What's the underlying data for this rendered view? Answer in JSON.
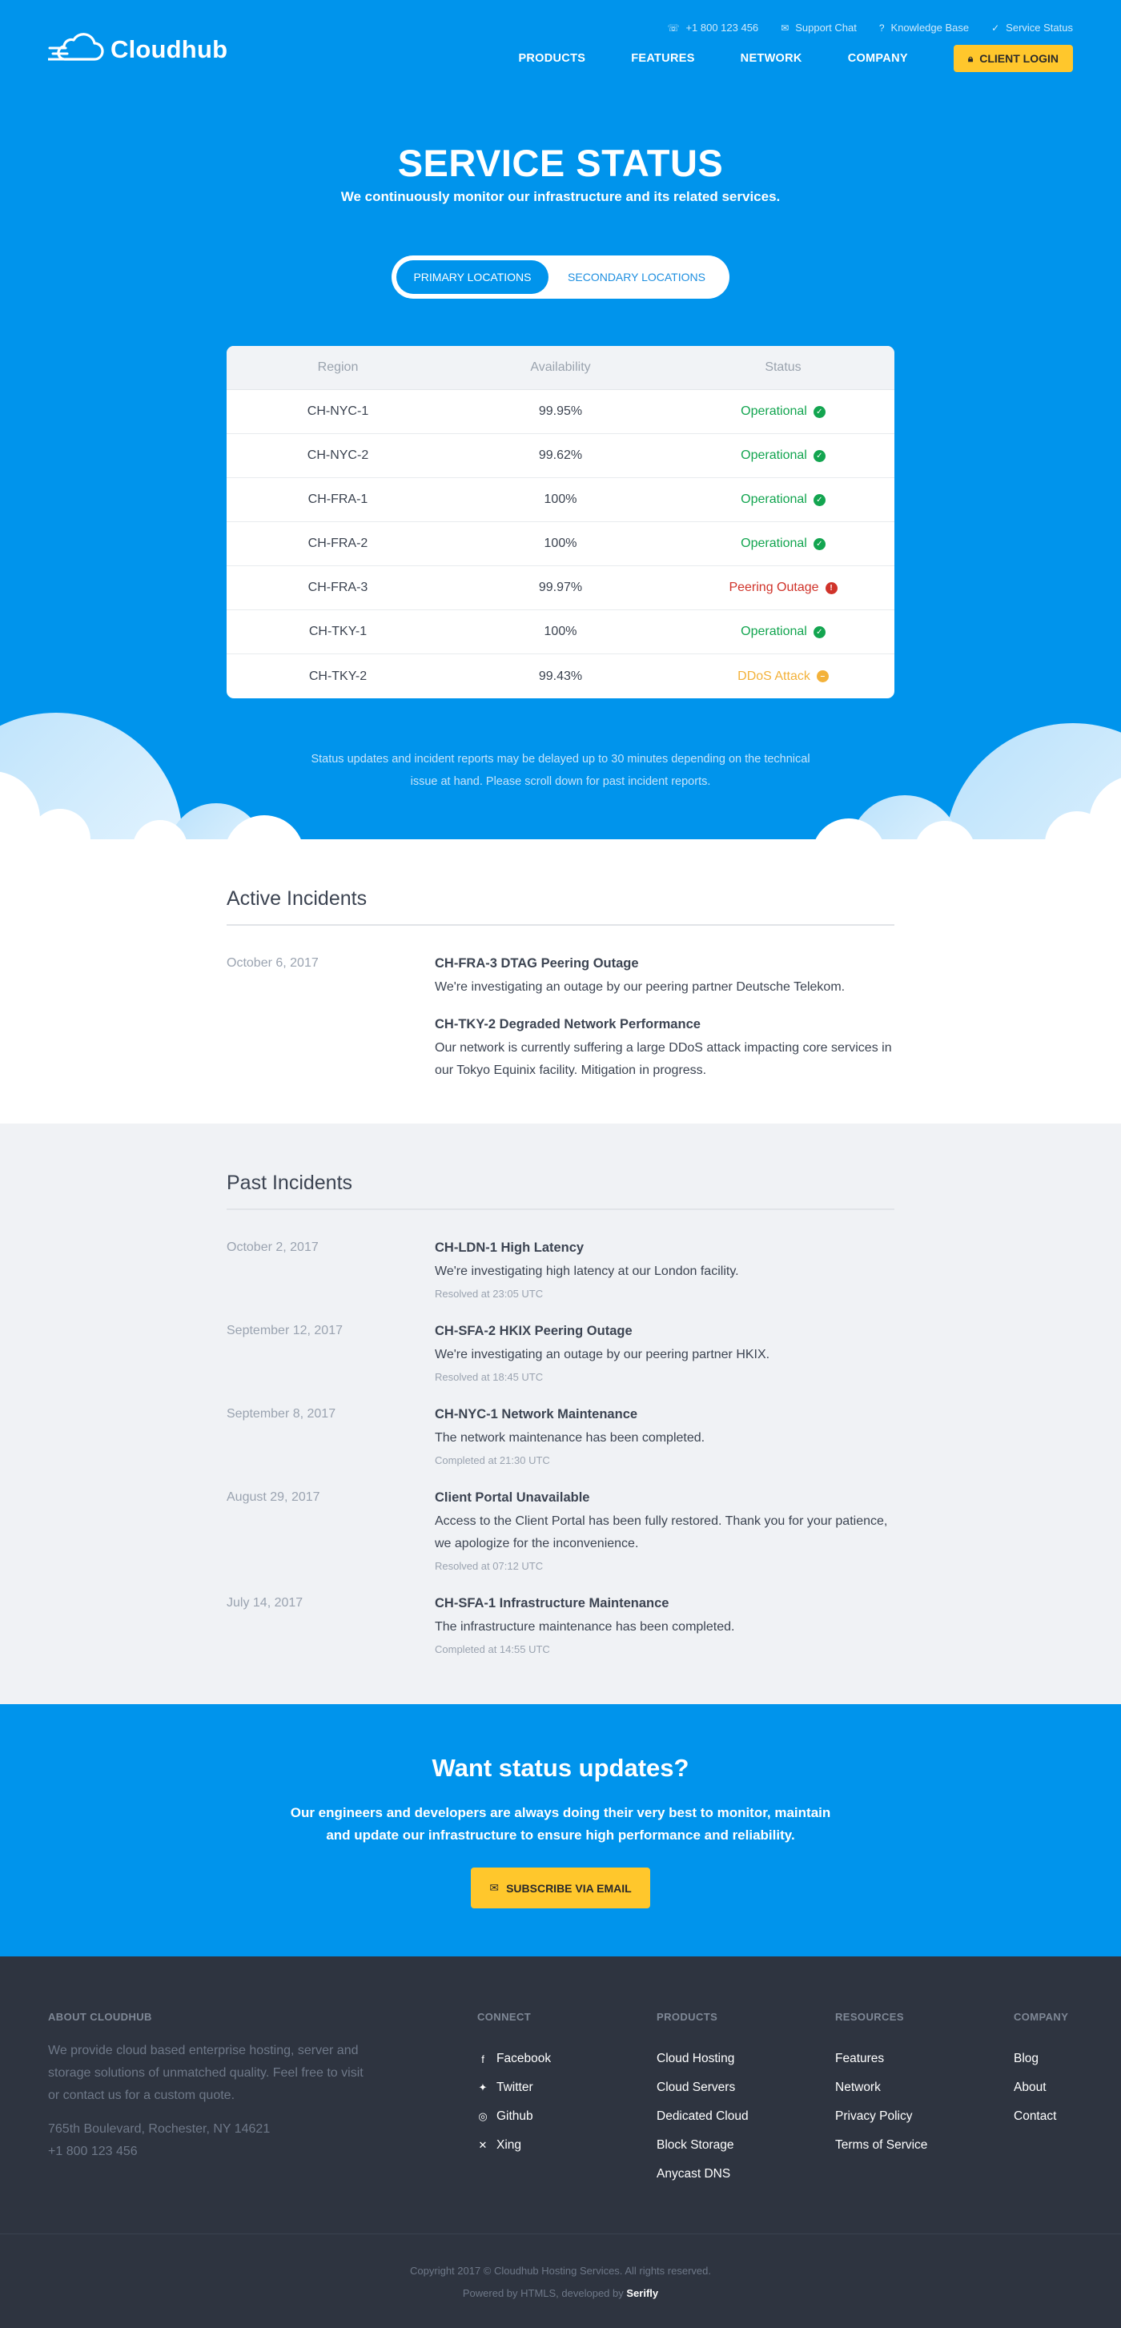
{
  "header": {
    "brand": "Cloudhub",
    "utility": [
      {
        "icon": "phone-icon",
        "glyph": "☏",
        "label": "+1 800 123 456"
      },
      {
        "icon": "chat-icon",
        "glyph": "✉",
        "label": "Support Chat"
      },
      {
        "icon": "question-icon",
        "glyph": "?",
        "label": "Knowledge Base"
      },
      {
        "icon": "check-icon",
        "glyph": "✓",
        "label": "Service Status"
      }
    ],
    "nav": [
      "PRODUCTS",
      "FEATURES",
      "NETWORK",
      "COMPANY"
    ],
    "login_label": "CLIENT LOGIN"
  },
  "hero": {
    "title": "SERVICE STATUS",
    "subtitle": "We continuously monitor our infrastructure and its related services.",
    "tabs": {
      "primary": "PRIMARY LOCATIONS",
      "secondary": "SECONDARY LOCATIONS"
    },
    "note": "Status updates and incident reports may be delayed up to 30 minutes depending on the technical issue at hand. Please scroll down for past incident reports."
  },
  "status_table": {
    "headers": [
      "Region",
      "Availability",
      "Status"
    ],
    "rows": [
      {
        "region": "CH-NYC-1",
        "availability": "99.95%",
        "status": "Operational",
        "kind": "green"
      },
      {
        "region": "CH-NYC-2",
        "availability": "99.62%",
        "status": "Operational",
        "kind": "green"
      },
      {
        "region": "CH-FRA-1",
        "availability": "100%",
        "status": "Operational",
        "kind": "green"
      },
      {
        "region": "CH-FRA-2",
        "availability": "100%",
        "status": "Operational",
        "kind": "green"
      },
      {
        "region": "CH-FRA-3",
        "availability": "99.97%",
        "status": "Peering Outage",
        "kind": "red"
      },
      {
        "region": "CH-TKY-1",
        "availability": "100%",
        "status": "Operational",
        "kind": "green"
      },
      {
        "region": "CH-TKY-2",
        "availability": "99.43%",
        "status": "DDoS Attack",
        "kind": "yellow"
      }
    ]
  },
  "active_incidents": {
    "title": "Active Incidents",
    "date": "October 6, 2017",
    "items": [
      {
        "title": "CH-FRA-3 DTAG Peering Outage",
        "text": "We're investigating an outage by our peering partner Deutsche Telekom."
      },
      {
        "title": "CH-TKY-2 Degraded Network Performance",
        "text": "Our network is currently suffering a large DDoS attack impacting core services in our Tokyo Equinix facility. Mitigation in progress."
      }
    ]
  },
  "past_incidents": {
    "title": "Past Incidents",
    "items": [
      {
        "date": "October 2, 2017",
        "title": "CH-LDN-1 High Latency",
        "text": "We're investigating high latency at our London facility.",
        "meta": "Resolved at 23:05 UTC"
      },
      {
        "date": "September 12, 2017",
        "title": "CH-SFA-2 HKIX Peering Outage",
        "text": "We're investigating an outage by our peering partner HKIX.",
        "meta": "Resolved at 18:45 UTC"
      },
      {
        "date": "September 8, 2017",
        "title": "CH-NYC-1 Network Maintenance",
        "text": "The network maintenance has been completed.",
        "meta": "Completed at 21:30 UTC"
      },
      {
        "date": "August 29, 2017",
        "title": "Client Portal Unavailable",
        "text": "Access to the Client Portal has been fully restored. Thank you for your patience, we apologize for the inconvenience.",
        "meta": "Resolved at 07:12 UTC"
      },
      {
        "date": "July 14, 2017",
        "title": "CH-SFA-1 Infrastructure Maintenance",
        "text": "The infrastructure maintenance has been completed.",
        "meta": "Completed at 14:55 UTC"
      }
    ]
  },
  "cta": {
    "title": "Want status updates?",
    "text": "Our engineers and developers are always doing their very best to monitor, maintain and update our infrastructure to ensure high performance and reliability.",
    "button": "SUBSCRIBE VIA EMAIL"
  },
  "footer": {
    "about_title": "ABOUT CLOUDHUB",
    "about_text": "We provide cloud based enterprise hosting, server and storage solutions of unmatched quality. Feel free to visit or contact us for a custom quote.",
    "address": "765th Boulevard, Rochester, NY 14621",
    "phone": "+1 800 123 456",
    "connect_title": "CONNECT",
    "connect": [
      {
        "label": "Facebook",
        "icon": "facebook-icon",
        "glyph": "f"
      },
      {
        "label": "Twitter",
        "icon": "twitter-icon",
        "glyph": "✦"
      },
      {
        "label": "Github",
        "icon": "github-icon",
        "glyph": "◎"
      },
      {
        "label": "Xing",
        "icon": "xing-icon",
        "glyph": "✕"
      }
    ],
    "products_title": "PRODUCTS",
    "products": [
      "Cloud Hosting",
      "Cloud Servers",
      "Dedicated Cloud",
      "Block Storage",
      "Anycast DNS"
    ],
    "resources_title": "RESOURCES",
    "resources": [
      "Features",
      "Network",
      "Privacy Policy",
      "Terms of Service"
    ],
    "company_title": "COMPANY",
    "company": [
      "Blog",
      "About",
      "Contact"
    ],
    "copyright": "Copyright 2017 © Cloudhub Hosting Services. All rights reserved.",
    "powered_prefix": "Powered by HTMLS, developed by",
    "developer": "Serifly"
  },
  "colors": {
    "brand_blue": "#0094ec",
    "accent_yellow": "#ffc72c",
    "operational": "#13a550",
    "outage": "#d0332a",
    "warning": "#f3b23b",
    "footer_bg": "#2e3440",
    "past_bg": "#f0f2f5"
  }
}
